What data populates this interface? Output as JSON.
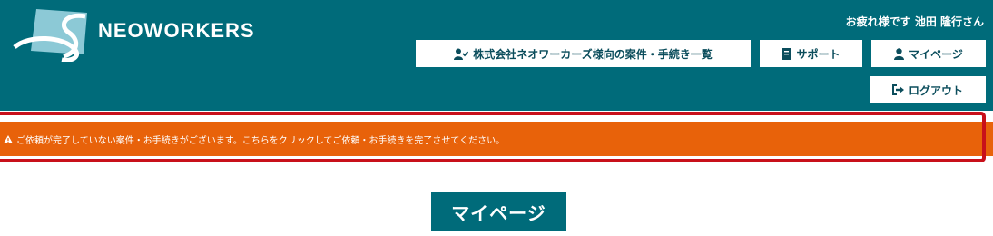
{
  "header": {
    "logo_text": "NEOWORKERS",
    "greeting": "お疲れ様です 池田 隆行さん"
  },
  "nav": {
    "cases_label": "株式会社ネオワーカーズ様向の案件・手続き一覧",
    "support_label": "サポート",
    "mypage_label": "マイページ",
    "logout_label": "ログアウト"
  },
  "alert": {
    "message": "ご依頼が完了していない案件・お手続きがございます。こちらをクリックしてご依頼・お手続きを完了させてください。"
  },
  "main": {
    "page_title": "マイページ"
  },
  "colors": {
    "header_bg": "#006b7a",
    "alert_bg": "#e8620a",
    "alert_frame": "#c8101a",
    "logo_light": "#8cc9d6"
  },
  "icons": {
    "cases": "user-check-icon",
    "support": "book-icon",
    "mypage": "user-icon",
    "logout": "sign-out-icon",
    "alert": "warning-icon"
  }
}
